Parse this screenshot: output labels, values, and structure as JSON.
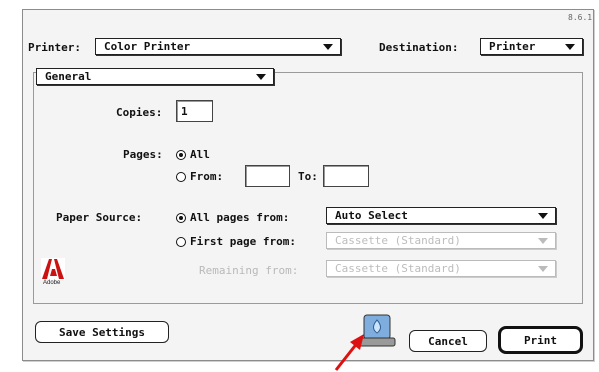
{
  "version": "8.6.1",
  "printer": {
    "label": "Printer:",
    "value": "Color Printer"
  },
  "destination": {
    "label": "Destination:",
    "value": "Printer"
  },
  "panel": {
    "value": "General"
  },
  "copies": {
    "label": "Copies:",
    "value": "1"
  },
  "pages": {
    "label": "Pages:",
    "all_label": "All",
    "from_label": "From:",
    "to_label": "To:",
    "from_value": "",
    "to_value": ""
  },
  "paper_source": {
    "label": "Paper Source:",
    "all_pages_label": "All pages from:",
    "all_pages_value": "Auto Select",
    "first_page_label": "First page from:",
    "first_page_value": "Cassette (Standard)",
    "remaining_label": "Remaining from:",
    "remaining_value": "Cassette (Standard)"
  },
  "buttons": {
    "save_settings": "Save Settings",
    "cancel": "Cancel",
    "print": "Print"
  },
  "logo": {
    "text": "Adobe",
    "color": "#cc1111"
  },
  "accent": {
    "pointer_arrow": "#dd1111"
  }
}
